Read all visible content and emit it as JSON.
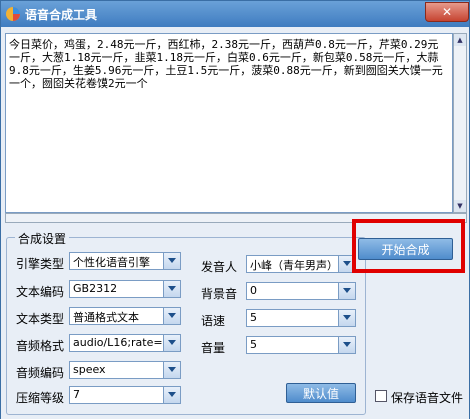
{
  "window": {
    "title": "语音合成工具",
    "close": "✕"
  },
  "text_content": "今日菜价，鸡蛋，2.48元一斤，西红柿，2.38元一斤，西葫芦0.8元一斤，芹菜0.29元一斤，大葱1.18元一斤，韭菜1.18元一斤，白菜0.6元一斤，新包菜0.58元一斤，大蒜9.8元一斤，生姜5.96元一斤，土豆1.5元一斤，菠菜0.88元一斤，新到囫囵关大馍一元一个，囫囵关花卷馍2元一个",
  "settings": {
    "group_title": "合成设置",
    "engine": {
      "label": "引擎类型",
      "value": "个性化语音引擎"
    },
    "encoding": {
      "label": "文本编码",
      "value": "GB2312"
    },
    "text_type": {
      "label": "文本类型",
      "value": "普通格式文本"
    },
    "audio_format": {
      "label": "音频格式",
      "value": "audio/L16;rate="
    },
    "audio_codec": {
      "label": "音频编码",
      "value": "speex"
    },
    "compress": {
      "label": "压缩等级",
      "value": "7"
    },
    "speaker": {
      "label": "发音人",
      "value": "小峰（青年男声）"
    },
    "bg_sound": {
      "label": "背景音",
      "value": "0"
    },
    "speed": {
      "label": "语速",
      "value": "5"
    },
    "volume": {
      "label": "音量",
      "value": "5"
    },
    "default_btn": "默认值"
  },
  "start_btn": "开始合成",
  "save_audio": "保存语音文件",
  "colors": {
    "highlight": "#e00000",
    "button": "#4f8ccc"
  }
}
